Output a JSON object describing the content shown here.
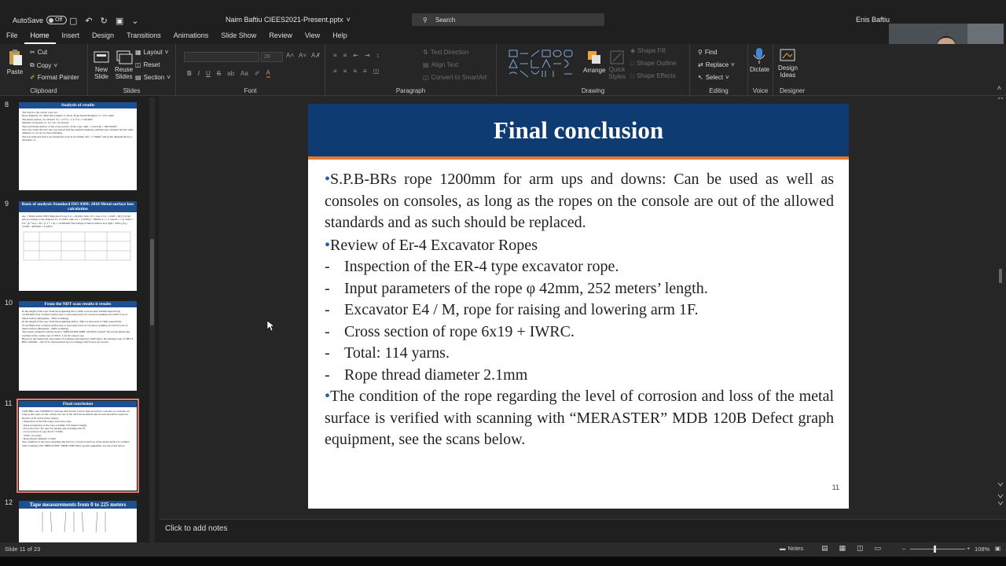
{
  "titlebar": {
    "autosave_label": "AutoSave",
    "autosave_state": "Off",
    "file_name": "Naim Baftiu CIEES2021-Present.pptx",
    "search_placeholder": "Search",
    "user_name": "Enis Baftiu"
  },
  "menu": [
    "File",
    "Home",
    "Insert",
    "Design",
    "Transitions",
    "Animations",
    "Slide Show",
    "Review",
    "View",
    "Help"
  ],
  "menu_active": "Home",
  "ribbon": {
    "clipboard": {
      "paste": "Paste",
      "cut": "Cut",
      "copy": "Copy",
      "format_painter": "Format Painter",
      "label": "Clipboard"
    },
    "slides": {
      "new_slide_1": "New",
      "new_slide_2": "Slide",
      "reuse_1": "Reuse",
      "reuse_2": "Slides",
      "layout": "Layout",
      "reset": "Reset",
      "section": "Section",
      "label": "Slides"
    },
    "font": {
      "size": "28",
      "label": "Font"
    },
    "paragraph": {
      "text_direction": "Text Direction",
      "align_text": "Align Text",
      "convert_smartart": "Convert to SmartArt",
      "label": "Paragraph"
    },
    "drawing": {
      "arrange": "Arrange",
      "quick_1": "Quick",
      "quick_2": "Styles",
      "shape_fill": "Shape Fill",
      "shape_outline": "Shape Outline",
      "shape_effects": "Shape Effects",
      "label": "Drawing"
    },
    "editing": {
      "find": "Find",
      "replace": "Replace",
      "select": "Select",
      "label": "Editing"
    },
    "voice": {
      "dictate": "Dictate",
      "label": "Voice"
    },
    "designer": {
      "design_1": "Design",
      "design_2": "Ideas",
      "label": "Designer"
    }
  },
  "thumbnails": [
    {
      "number": "8",
      "title": "Analysis of results",
      "lines": [
        "The data for the carrier rope are:",
        "Rope diameter: D =Ø42 mm Length: L=45 m, Rope thread diameter: d = Ø 2.1mm.",
        "The metal surface of a thread: Sf = π·d²/4 = π·2.1²/4 = 3.46 mm².",
        "Number of threads: n= 6 x 19= 114 thread.",
        "The total metal surface of the cross section of the rope: Spm = 114x3.46 = 460.61mm².",
        "The rope when the new one was placed had the nominal diameter φ42mm and currently has the same diameter so we do not have thinning.",
        "The test indicator that is set during the scan is φ3.15mm, Sm = 7.76mm² and in the diagram shows a deviation of"
      ]
    },
    {
      "number": "9",
      "title": "Basis of analysis Standard ISO 4309: 2010 Metal surface loss calculation",
      "lines": [
        "Aw = 3mm read in NDT diagram of rope Cw = 20 mm / mm, Uv = Aw x Cw = 3x20 = 60 [v] from this according to the diagram Uv vs ΔSFe, take Ux = f (ΔSFe) = 30mm/ k = 1.1 and ks = 1.4, ΔSFe = Ux / (k * ks) = 30 / (1.1 * 1.4) = 19.481mm² Percentage of metal surface loss Spm / ΔSFe [%] = 19.481 / 460.600 = 4.229%."
      ]
    },
    {
      "number": "10",
      "title": "From the NDT scan results it results",
      "lines": [
        "In the length of the rope from the beginning 0m to 20m we have max 3.6mm respectively 19.481mm2 loss of metal surface due to increased level of corrosion resulting in 4.229% loss of metal surface (Diagrams - NDT scanning).",
        "In the length of the rope from the beginning 20m to 33m we have max 3.7mm respectively 21.227mm2 loss of metal surface due to increased level of corrosion resulting in 4.613% loss of metal surface (Diagrams - NDT scanning).",
        "The results obtained with the device \"MERASTER MDB 120 Defect graph\" have been physically verified in the carrier rope of SH.V. I, for the tested rope.",
        "Based on the inspection, the results of scanning and physical verification, the existing rope of SH.VI. BRs 1200mm - arm 1F is characterized by low damage which does not exceed"
      ]
    },
    {
      "number": "11",
      "title": "Final conclusion",
      "lines": [
        "S.P.B-BRs rope 1200mm for arm ups and downs: Can be used as well as consoles on consoles, as long as the ropes on the console are out of the allowed standards and as such should be replaced.",
        "Review of Er-4 Excavator Ropes",
        "- Inspection of the ER-4 type excavator rope.",
        "- Input parameters of the rope φ 42mm, 252 meters' length.",
        "- Excavator E4 / M, rope for raising and lowering arm 1F.",
        "- Cross section of rope 6x19 + IWRC.",
        "- Total: 114 yarns.",
        "- Rope thread diameter 2.1mm",
        "The condition of the rope regarding the level of corrosion and loss of the metal surface is verified with scanning with \"MERASTER\" MDB 120B Defect graph equipment, see the scans below."
      ]
    },
    {
      "number": "12",
      "title": "Tape measurements from 0 to 225 meters",
      "lines": []
    }
  ],
  "slide": {
    "title": "Final conclusion",
    "para1": "S.P.B-BRs rope 1200mm for arm ups and downs: Can be used as well as consoles on consoles, as long as the ropes on the console are out of the allowed standards and as such should be replaced.",
    "para2": "Review of Er-4 Excavator Ropes",
    "dash_items": [
      "Inspection of the ER-4 type excavator rope.",
      "Input parameters of the rope φ 42mm, 252 meters’ length.",
      "Excavator E4 / M, rope for raising and lowering arm 1F.",
      "Cross section of rope 6x19 + IWRC.",
      "Total: 114 yarns.",
      "Rope thread diameter 2.1mm"
    ],
    "para3": "The condition of the rope regarding the level of corrosion and loss of the metal surface is verified with scanning with “MERASTER” MDB 120B Defect graph equipment, see the scans below.",
    "page_number": "11",
    "bullet": "•",
    "dash": "-"
  },
  "notes_placeholder": "Click to add notes",
  "status": {
    "slide_info": "Slide 11 of 23",
    "notes_label": "Notes",
    "zoom": "108%"
  },
  "colors": {
    "title_bar": "#0f3b73",
    "title_accent": "#e8792c",
    "bullet": "#1e5bbf",
    "selected_thumb": "#e07a6b"
  }
}
